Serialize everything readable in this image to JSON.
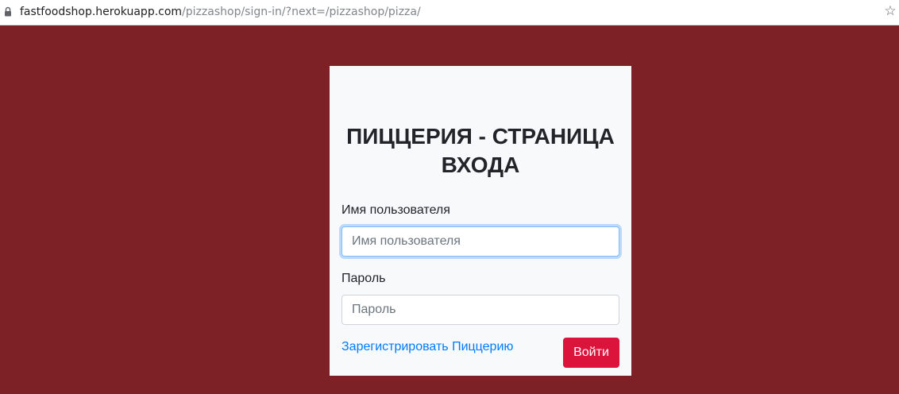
{
  "browser": {
    "url_host": "fastfoodshop.herokuapp.com",
    "url_path": "/pizzashop/sign-in/?next=/pizzashop/pizza/",
    "lock_icon": "lock-icon",
    "bookmark_icon": "star-icon"
  },
  "login": {
    "title": "ПИЦЦЕРИЯ - СТРАНИЦА ВХОДА",
    "username_label": "Имя пользователя",
    "username_placeholder": "Имя пользователя",
    "username_value": "",
    "password_label": "Пароль",
    "password_placeholder": "Пароль",
    "password_value": "",
    "register_link": "Зарегистрировать Пиццерию",
    "submit_label": "Войти"
  },
  "colors": {
    "page_background": "#7d2126",
    "card_background": "#f8f9fa",
    "link": "#007bff",
    "submit_button": "#dc143c",
    "focus_ring": "#80bdff"
  }
}
